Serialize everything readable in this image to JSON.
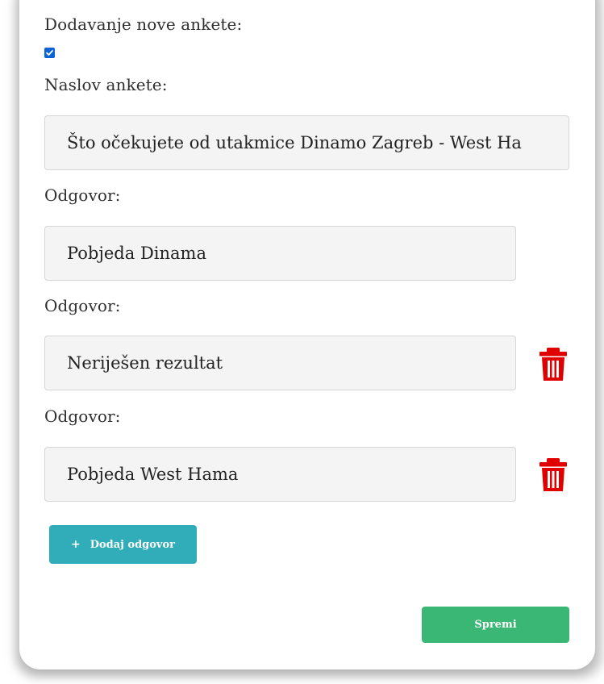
{
  "form": {
    "new_poll_label": "Dodavanje nove ankete:",
    "new_poll_checked": true,
    "title_label": "Naslov ankete:",
    "title_value": "Što očekujete od utakmice Dinamo Zagreb - West Ha",
    "answers": [
      {
        "label": "Odgovor:",
        "value": "Pobjeda Dinama",
        "deletable": false
      },
      {
        "label": "Odgovor:",
        "value": "Neriješen rezultat",
        "deletable": true
      },
      {
        "label": "Odgovor:",
        "value": "Pobjeda West Hama",
        "deletable": true
      }
    ],
    "add_answer_icon": "+",
    "add_answer_label": "Dodaj odgovor",
    "save_label": "Spremi"
  },
  "colors": {
    "checkbox": "#0a64d6",
    "trash_icon": "#e00000",
    "add_button": "#31adba",
    "save_button": "#3ab774"
  }
}
